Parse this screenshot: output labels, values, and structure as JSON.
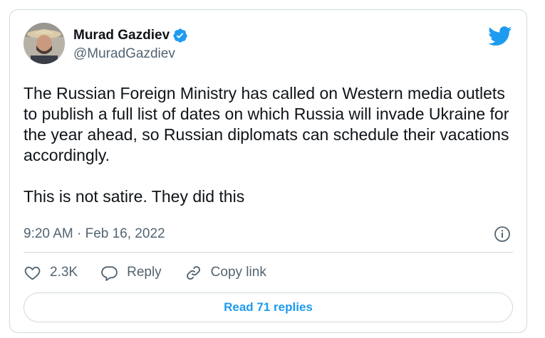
{
  "author": {
    "name": "Murad Gazdiev",
    "handle": "@MuradGazdiev",
    "verified": true
  },
  "tweet": {
    "text": "The Russian Foreign Ministry has called on Western media outlets to publish a full list of dates on which Russia will invade Ukraine for the year ahead, so Russian diplomats can schedule their vacations accordingly.\n\nThis is not satire. They did this",
    "timestamp": "9:20 AM · Feb 16, 2022"
  },
  "actions": {
    "like_count": "2.3K",
    "reply_label": "Reply",
    "copy_link_label": "Copy link"
  },
  "footer": {
    "read_replies_label": "Read 71 replies"
  },
  "colors": {
    "brand_blue": "#1d9bf0",
    "secondary_text": "#536471",
    "border": "#cfd9de"
  },
  "icons": [
    "verified-badge-icon",
    "twitter-bird-icon",
    "info-icon",
    "heart-icon",
    "reply-icon",
    "link-icon"
  ]
}
